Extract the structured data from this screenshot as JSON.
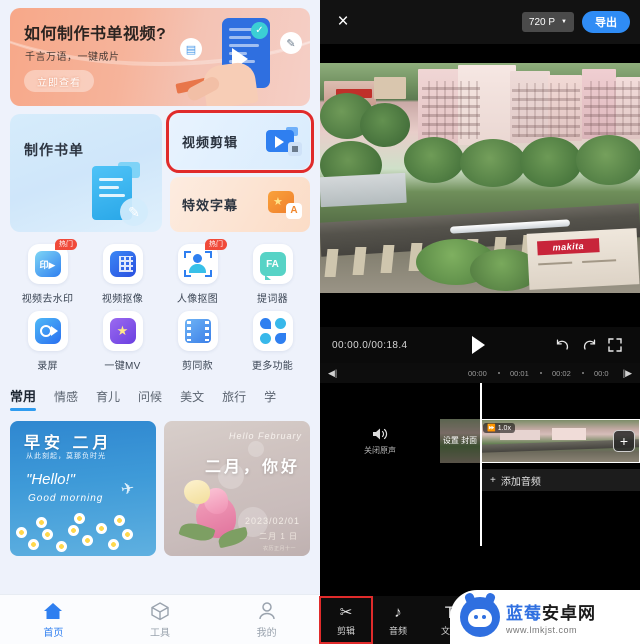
{
  "left": {
    "banner": {
      "title": "如何制作书单视频?",
      "subtitle": "千言万语，一键成片",
      "cta": "立即查看"
    },
    "features": {
      "bookist": "制作书单",
      "video_edit": "视频剪辑",
      "subtitle_fx": "特效字幕"
    },
    "grid": [
      {
        "label": "视频去水印",
        "badge": "热门",
        "icon": "watermark-remove-icon"
      },
      {
        "label": "视频抠像",
        "badge": "",
        "icon": "video-keying-icon"
      },
      {
        "label": "人像抠图",
        "badge": "热门",
        "icon": "portrait-cutout-icon"
      },
      {
        "label": "提词器",
        "badge": "",
        "icon": "teleprompter-icon"
      },
      {
        "label": "录屏",
        "badge": "",
        "icon": "screen-record-icon"
      },
      {
        "label": "一键MV",
        "badge": "",
        "icon": "one-tap-mv-icon"
      },
      {
        "label": "剪同款",
        "badge": "",
        "icon": "template-cut-icon"
      },
      {
        "label": "更多功能",
        "badge": "",
        "icon": "more-functions-icon"
      }
    ],
    "tabs": [
      {
        "label": "常用",
        "active": true
      },
      {
        "label": "情感",
        "active": false
      },
      {
        "label": "育儿",
        "active": false
      },
      {
        "label": "问候",
        "active": false
      },
      {
        "label": "美文",
        "active": false
      },
      {
        "label": "旅行",
        "active": false
      },
      {
        "label": "学",
        "active": false
      }
    ],
    "templates": {
      "card1": {
        "heading": "早安 二月",
        "sub": "从此刻起，莫那负时光",
        "en_big": "\"Hello!\"",
        "en_small": "Good morning"
      },
      "card2": {
        "script": "Hello February",
        "heading": "二月，你好",
        "date": "2023/02/01",
        "date_cn": "二月 1 日",
        "date_small": "农历正月十一"
      }
    },
    "nav": [
      {
        "label": "首页",
        "icon": "home-icon",
        "active": true
      },
      {
        "label": "工具",
        "icon": "cube-tools-icon",
        "active": false
      },
      {
        "label": "我的",
        "icon": "person-icon",
        "active": false
      }
    ]
  },
  "right": {
    "topbar": {
      "close": "×",
      "quality": "720 P",
      "export": "导出"
    },
    "player": {
      "time": "00:00.0/00:18.4",
      "play": "play-icon",
      "undo": "undo-icon",
      "redo": "redo-icon",
      "fullscreen": "fullscreen-icon"
    },
    "preview": {
      "sign_text": "makita"
    },
    "ruler": {
      "start": "skip-start-icon",
      "end": "skip-end-icon",
      "ticks": [
        "00:00",
        "00:01",
        "00:02",
        "00:0"
      ]
    },
    "timeline": {
      "mute_label": "关闭原声",
      "cover_label": "设置\n封面",
      "speed_badge": "1.0x",
      "add_clip": "+",
      "add_audio": "添加音频",
      "add_audio_plus": "+"
    },
    "tools": [
      {
        "label": "剪辑",
        "icon": "scissors-icon",
        "selected": true
      },
      {
        "label": "音频",
        "icon": "music-note-icon",
        "selected": false
      },
      {
        "label": "文字",
        "icon": "text-t-icon",
        "selected": false
      }
    ],
    "watermark": {
      "name_1": "蓝莓",
      "name_2": "安卓网",
      "url": "www.lmkjst.com"
    }
  }
}
